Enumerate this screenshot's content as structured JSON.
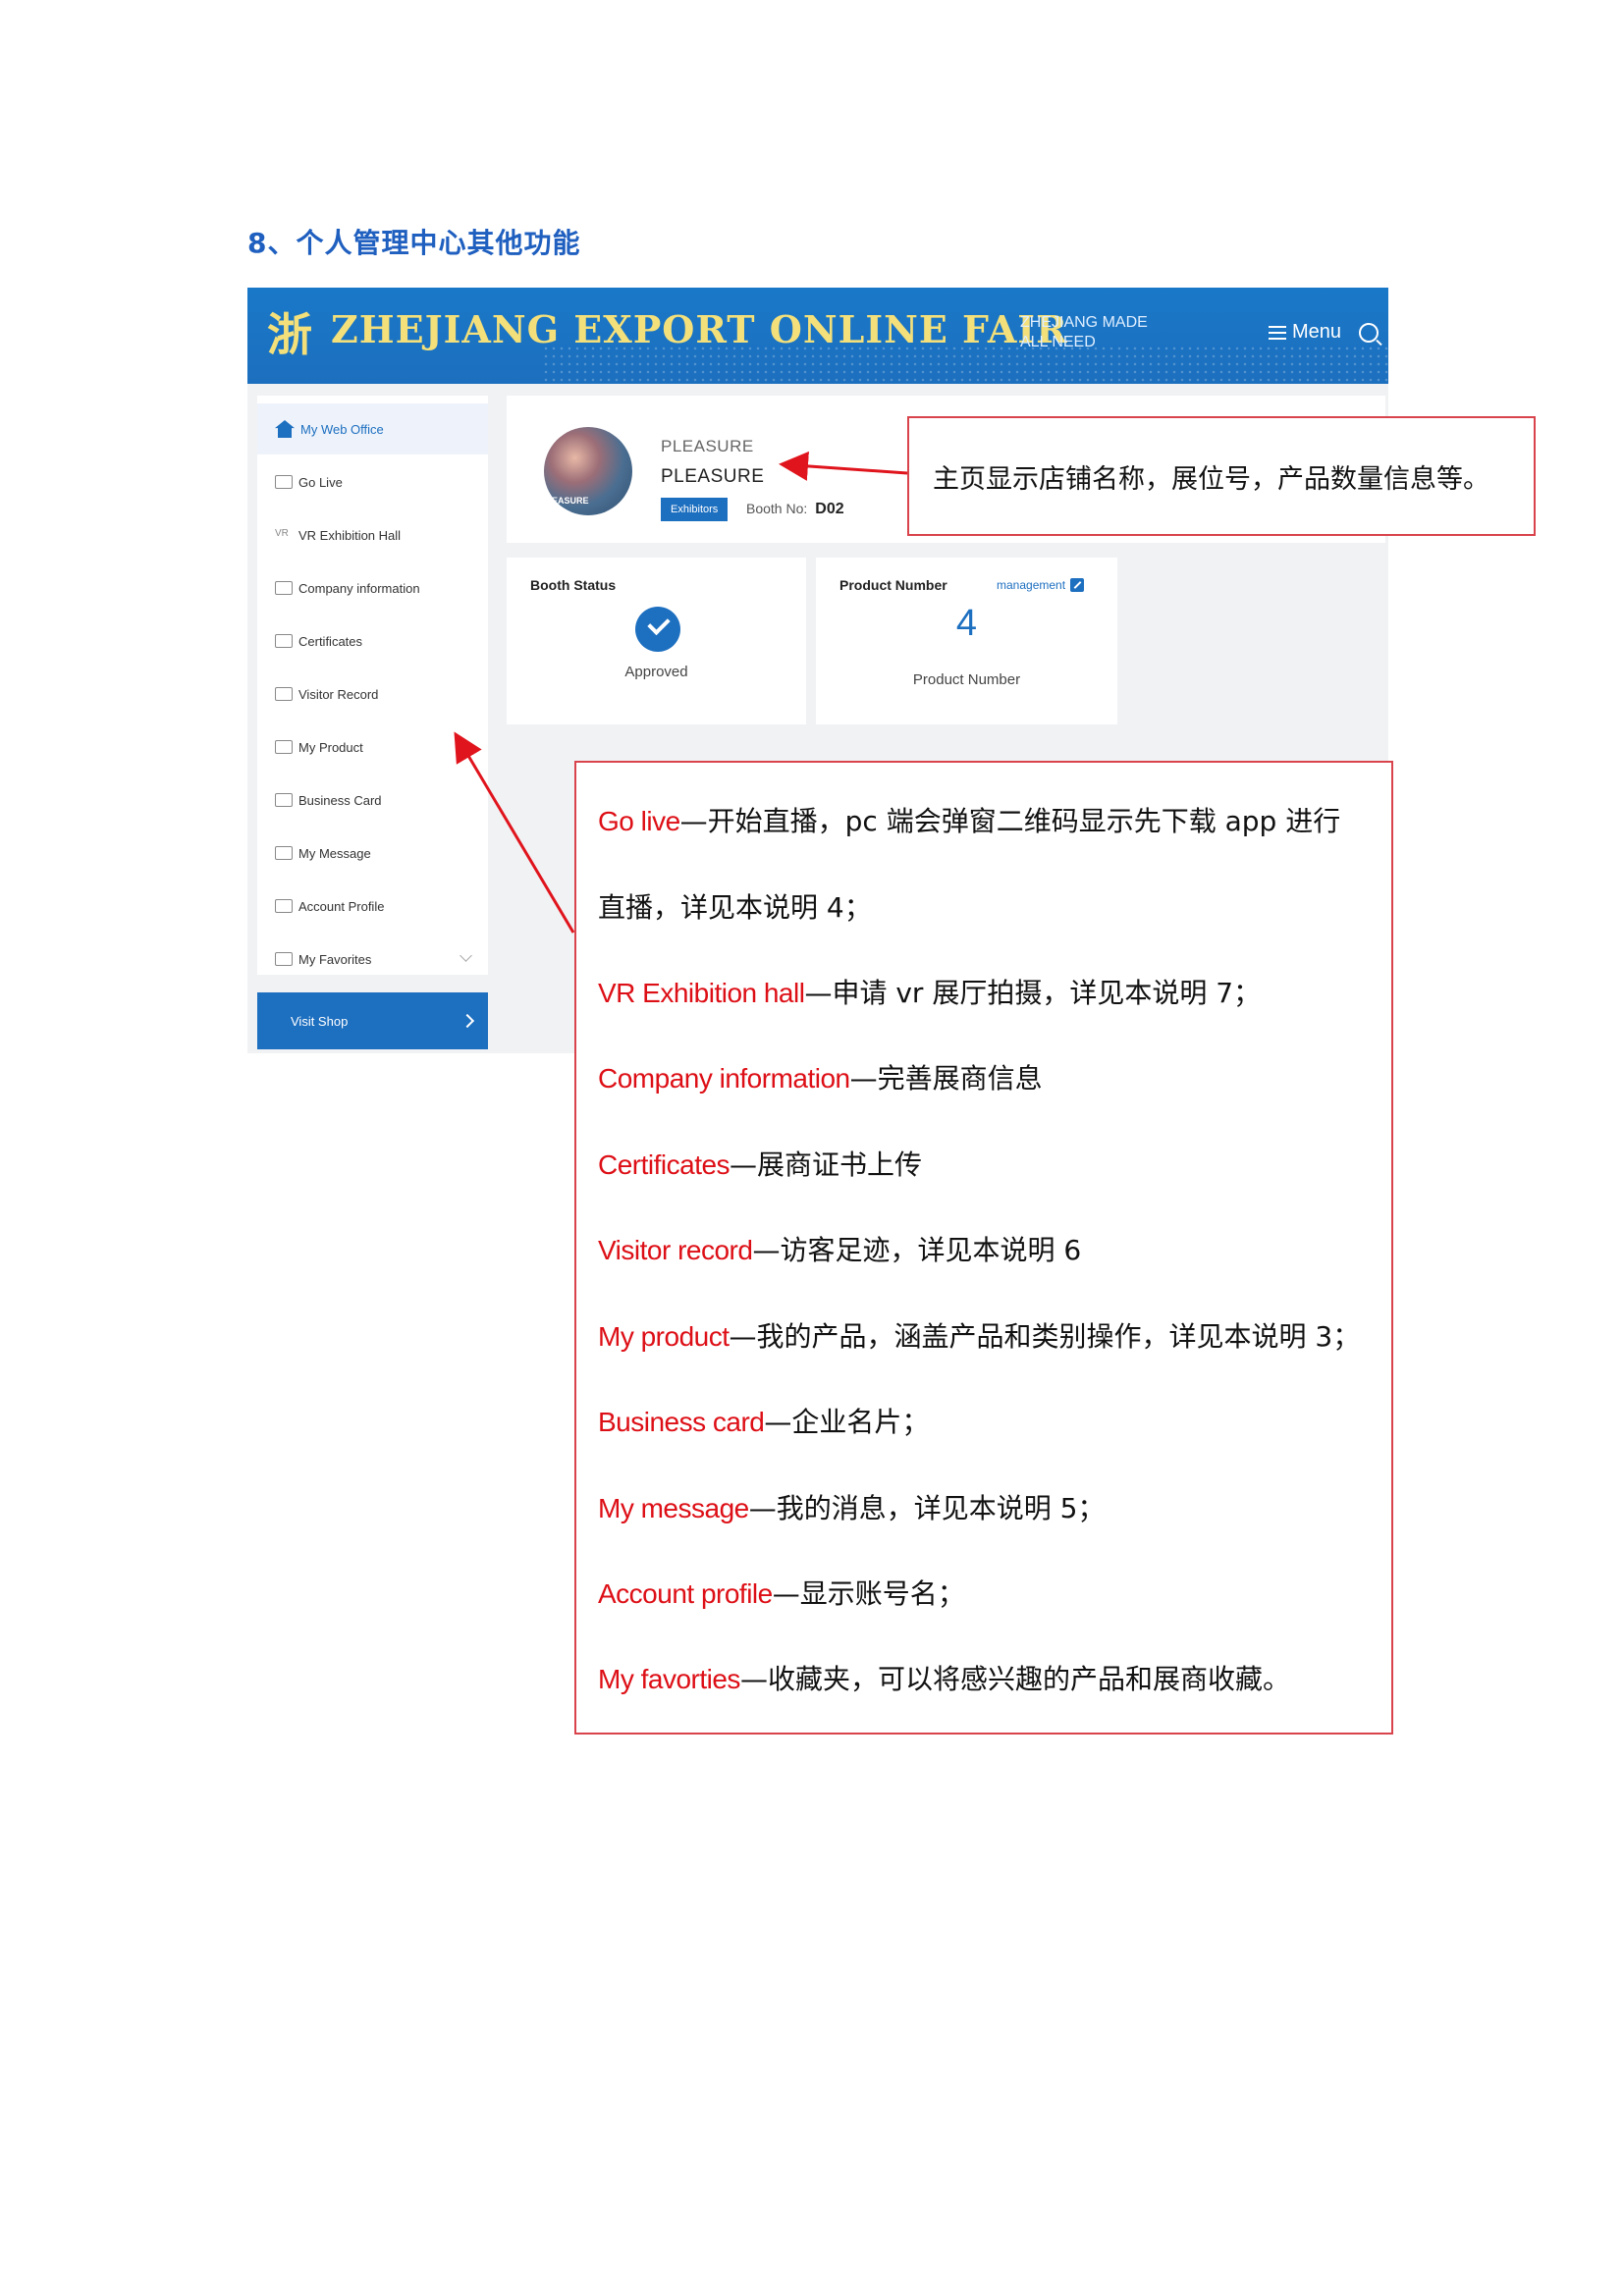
{
  "section_title": "8、个人管理中心其他功能",
  "banner": {
    "logo_char": "浙",
    "title": "ZHEJIANG EXPORT ONLINE FAIR",
    "tagline_1": "ZHEJIANG MADE",
    "tagline_2": "ALL NEED",
    "menu_label": "Menu"
  },
  "sidebar": {
    "items": [
      {
        "label": "My Web Office"
      },
      {
        "label": "Go Live"
      },
      {
        "label": "VR Exhibition Hall"
      },
      {
        "label": "Company information"
      },
      {
        "label": "Certificates"
      },
      {
        "label": "Visitor Record"
      },
      {
        "label": "My Product"
      },
      {
        "label": "Business Card"
      },
      {
        "label": "My Message"
      },
      {
        "label": "Account Profile"
      },
      {
        "label": "My Favorites"
      }
    ],
    "visit_shop": "Visit Shop"
  },
  "profile": {
    "avatar_text": "EASURE",
    "shop_name_small": "PLEASURE",
    "shop_name": "PLEASURE",
    "badge": "Exhibitors",
    "booth_label": "Booth No:",
    "booth_no": "D02"
  },
  "booth_status": {
    "title": "Booth Status",
    "status": "Approved"
  },
  "product_number": {
    "title": "Product Number",
    "management": "management",
    "value": "4",
    "caption": "Product Number"
  },
  "annotation_top": "主页显示店铺名称，展位号，产品数量信息等。",
  "descriptions": [
    {
      "term": "Go live",
      "text": "—开始直播，pc 端会弹窗二维码显示先下载 app 进行"
    },
    {
      "term": "",
      "text": "直播，详见本说明 4；"
    },
    {
      "term": "VR Exhibition hall",
      "text": "—申请 vr 展厅拍摄，详见本说明 7；"
    },
    {
      "term": "Company information",
      "text": "—完善展商信息"
    },
    {
      "term": "Certificates",
      "text": "—展商证书上传"
    },
    {
      "term": "Visitor record",
      "text": "—访客足迹，详见本说明 6"
    },
    {
      "term": "My product",
      "text": "—我的产品，涵盖产品和类别操作，详见本说明 3；"
    },
    {
      "term": "Business card",
      "text": "—企业名片；"
    },
    {
      "term": "My message",
      "text": "—我的消息，详见本说明 5；"
    },
    {
      "term": "Account profile",
      "text": "—显示账号名；"
    },
    {
      "term": "My favorties",
      "text": "—收藏夹，可以将感兴趣的产品和展商收藏。"
    }
  ],
  "colors": {
    "accent": "#1d6fc0",
    "annotation_red": "#d9434c",
    "term_red": "#dd0f16",
    "title_blue": "#1f5fbf"
  }
}
